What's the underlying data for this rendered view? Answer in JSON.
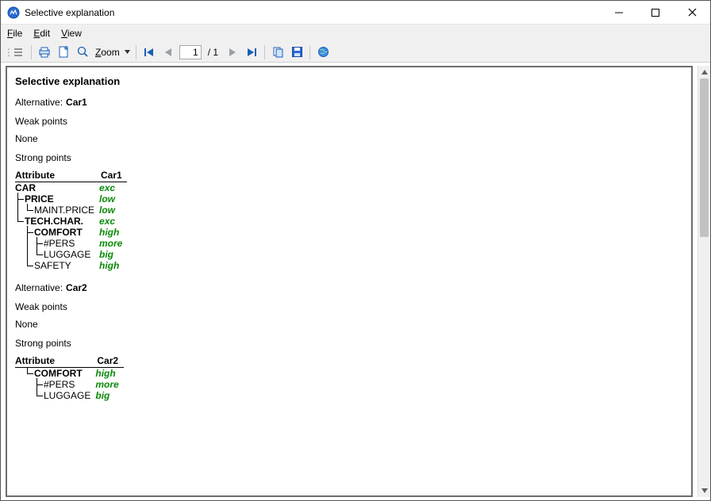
{
  "window": {
    "title": "Selective explanation"
  },
  "menu": {
    "file": "File",
    "edit": "Edit",
    "view": "View"
  },
  "toolbar": {
    "zoom_label": "Zoom",
    "page_value": "1",
    "page_total": "/ 1"
  },
  "doc": {
    "title": "Selective explanation",
    "alt_label": "Alternative:",
    "weak_points": "Weak points",
    "strong_points": "Strong points",
    "none": "None",
    "header_attr": "Attribute",
    "alternatives": [
      {
        "name": "Car1",
        "weak": [],
        "strong": [
          {
            "indent": [],
            "bold": true,
            "name": "CAR",
            "value": "exc"
          },
          {
            "indent": [
              "branch cont"
            ],
            "bold": true,
            "name": "PRICE",
            "value": "low"
          },
          {
            "indent": [
              "v",
              "last"
            ],
            "bold": false,
            "name": "MAINT.PRICE",
            "value": "low"
          },
          {
            "indent": [
              "last"
            ],
            "bold": true,
            "name": "TECH.CHAR.",
            "value": "exc"
          },
          {
            "indent": [
              "",
              "branch cont"
            ],
            "bold": true,
            "name": "COMFORT",
            "value": "high"
          },
          {
            "indent": [
              "",
              "v",
              "branch cont"
            ],
            "bold": false,
            "name": "#PERS",
            "value": "more"
          },
          {
            "indent": [
              "",
              "v",
              "last"
            ],
            "bold": false,
            "name": "LUGGAGE",
            "value": "big"
          },
          {
            "indent": [
              "",
              "last"
            ],
            "bold": false,
            "name": "SAFETY",
            "value": "high"
          }
        ]
      },
      {
        "name": "Car2",
        "weak": [],
        "strong": [
          {
            "indent": [
              "",
              "last"
            ],
            "bold": true,
            "name": "COMFORT",
            "value": "high"
          },
          {
            "indent": [
              "",
              "",
              "branch cont"
            ],
            "bold": false,
            "name": "#PERS",
            "value": "more"
          },
          {
            "indent": [
              "",
              "",
              "last"
            ],
            "bold": false,
            "name": "LUGGAGE",
            "value": "big"
          }
        ]
      }
    ]
  }
}
